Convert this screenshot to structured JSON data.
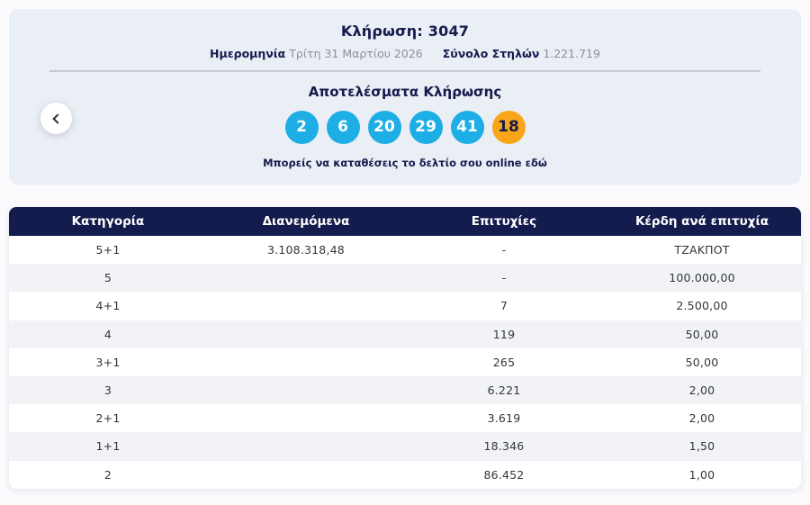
{
  "draw": {
    "title_label": "Κλήρωση:",
    "title_number": "3047",
    "date_label": "Ημερομηνία",
    "date_value": "Τρίτη 31 Μαρτίου 2026",
    "columns_label": "Σύνολο Στηλών",
    "columns_value": "1.221.719"
  },
  "results": {
    "title": "Αποτελέσματα Κλήρωσης",
    "numbers": [
      "2",
      "6",
      "20",
      "29",
      "41"
    ],
    "joker_number": "18",
    "deposit_link_text": "Μπορείς να καταθέσεις το δελτίο σου online εδώ"
  },
  "nav": {
    "prev_button": "chevron-left"
  },
  "colors": {
    "navy": "#141b4d",
    "ball_blue": "#1caee4",
    "ball_orange": "#f9a51a",
    "card_bg": "#eaeef5",
    "row_alt": "#f2f3f6"
  },
  "table": {
    "headers": [
      "Κατηγορία",
      "Διανεμόμενα",
      "Επιτυχίες",
      "Κέρδη ανά επιτυχία"
    ],
    "rows": [
      {
        "category": "5+1",
        "distributed": "3.108.318,48",
        "winners": "-",
        "prize": "ΤΖΑΚΠΟΤ"
      },
      {
        "category": "5",
        "distributed": "",
        "winners": "-",
        "prize": "100.000,00"
      },
      {
        "category": "4+1",
        "distributed": "",
        "winners": "7",
        "prize": "2.500,00"
      },
      {
        "category": "4",
        "distributed": "",
        "winners": "119",
        "prize": "50,00"
      },
      {
        "category": "3+1",
        "distributed": "",
        "winners": "265",
        "prize": "50,00"
      },
      {
        "category": "3",
        "distributed": "",
        "winners": "6.221",
        "prize": "2,00"
      },
      {
        "category": "2+1",
        "distributed": "",
        "winners": "3.619",
        "prize": "2,00"
      },
      {
        "category": "1+1",
        "distributed": "",
        "winners": "18.346",
        "prize": "1,50"
      },
      {
        "category": "2",
        "distributed": "",
        "winners": "86.452",
        "prize": "1,00"
      }
    ]
  }
}
